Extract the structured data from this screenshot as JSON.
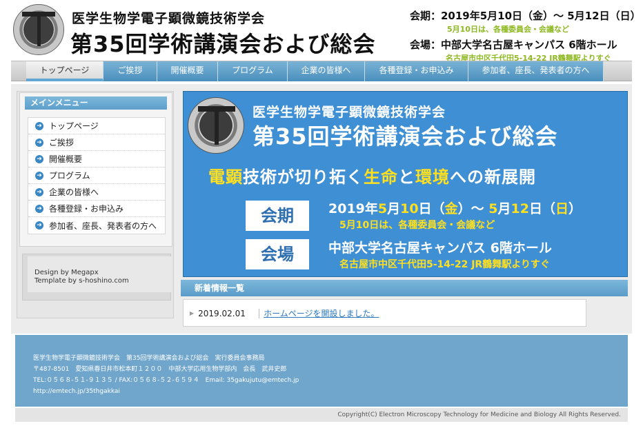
{
  "header": {
    "society": "医学生物学電子顕微鏡技術学会",
    "title": "第35回学術講演会および総会",
    "period_line": "会期：2019年5月10日（金）～ 5月12日（日）",
    "period_note": "5月10日は、各種委員会・会議など",
    "venue_line": "会場：中部大学名古屋キャンパス 6階ホール",
    "venue_note": "名古屋市中区千代田5-14-22 JR鶴舞駅よりすぐ"
  },
  "nav": [
    {
      "label": "トップページ",
      "active": true
    },
    {
      "label": "ご挨拶"
    },
    {
      "label": "開催概要"
    },
    {
      "label": "プログラム"
    },
    {
      "label": "企業の皆様へ"
    },
    {
      "label": "各種登録・お申込み"
    },
    {
      "label": "参加者、座長、発表者の方へ"
    }
  ],
  "sidebar": {
    "heading": "メインメニュー",
    "items": [
      {
        "label": "トップページ"
      },
      {
        "label": "ご挨拶"
      },
      {
        "label": "開催概要"
      },
      {
        "label": "プログラム"
      },
      {
        "label": "企業の皆様へ"
      },
      {
        "label": "各種登録・お申込み"
      },
      {
        "label": "参加者、座長、発表者の方へ"
      }
    ],
    "credit_design_prefix": "Design by ",
    "credit_design_link": "Megapx",
    "credit_template_prefix": "Template by ",
    "credit_template_link": "s-hoshino.com"
  },
  "banner": {
    "society": "医学生物学電子顕微鏡技術学会",
    "title": "第35回学術講演会および総会",
    "slogan_1": "電顕",
    "slogan_2": "技術が切り拓く",
    "slogan_3": "生命",
    "slogan_4": "と",
    "slogan_5": "環境",
    "slogan_6": "への新展開",
    "period_label": "会期",
    "date_1": "2019年",
    "date_2": "5",
    "date_3": "月",
    "date_4": "10",
    "date_5": "日（",
    "date_6": "金",
    "date_7": "）～ ",
    "date_8": "5",
    "date_9": "月",
    "date_10": "12",
    "date_11": "日（",
    "date_12": "日",
    "date_13": "）",
    "date_note": "5月10日は、各種委員会・会議など",
    "venue_label": "会場",
    "venue": "中部大学名古屋キャンパス 6階ホール",
    "venue_note": "名古屋市中区千代田5-14-22 JR鶴舞駅よりすぐ"
  },
  "news": {
    "heading": "新着情報一覧",
    "items": [
      {
        "date": "2019.02.01",
        "text": "ホームページを開設しました。"
      }
    ]
  },
  "footer": {
    "line1": "医学生物学電子顕微鏡技術学会　第35回学術講演会および総会　実行委員会事務局",
    "line2": "〒487-8501　愛知県春日井市松本町１２００　中部大学応用生物学部内　会長　武井史郎",
    "line3": "TEL:０５６８-５１-９１３５ / FAX:０５６８-５２-６５９４　Email: 35gakujutu@emtech.jp",
    "line4": "http://emtech.jp/35thgakkai",
    "copyright": "Copyright(C) Electron Microscopy Technology for Medicine and Biology All Rights Reserved."
  },
  "colors": {
    "accent_blue": "#4a8fbd",
    "banner_blue": "#3f8fd4",
    "highlight_yellow": "#ffe020",
    "note_green": "#8db820",
    "footer_blue": "#71a6cc"
  }
}
